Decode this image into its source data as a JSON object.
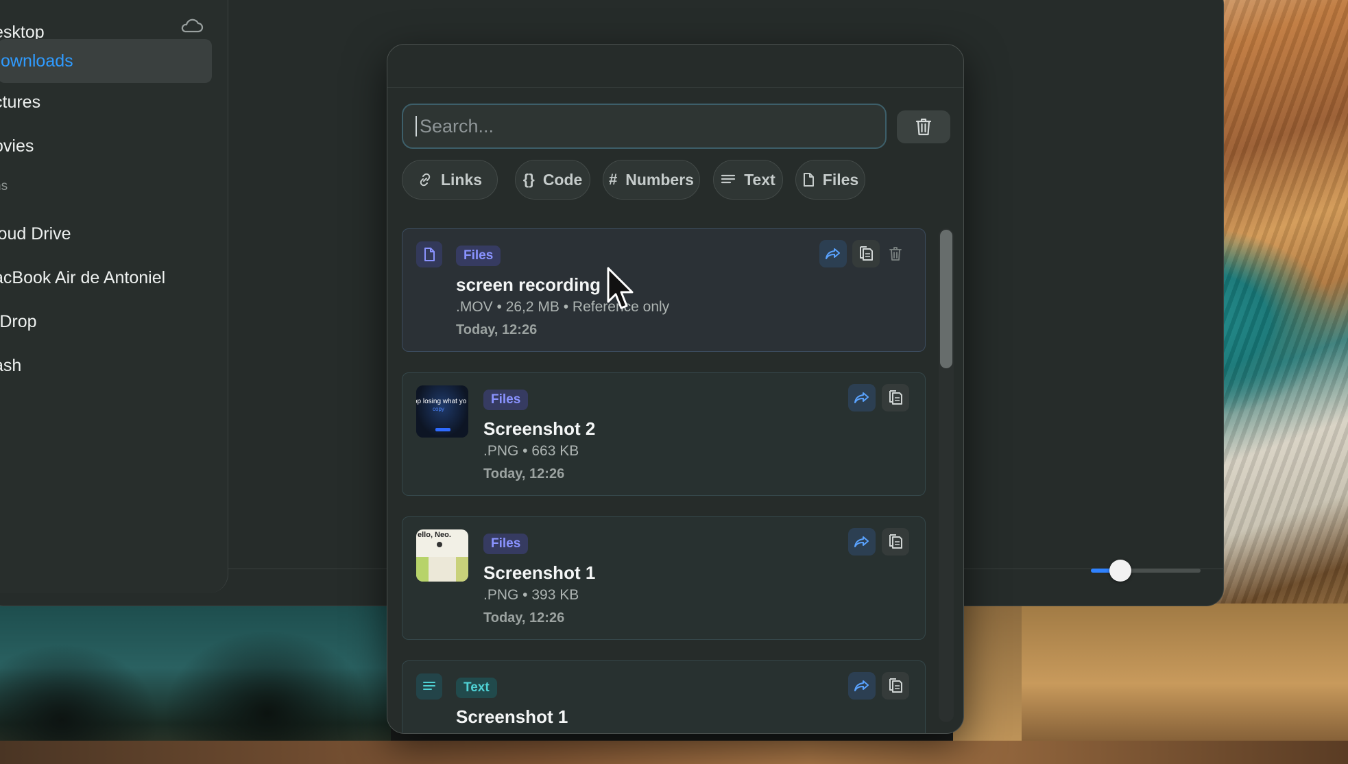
{
  "finder": {
    "sidebar": {
      "items": [
        {
          "label": "esktop",
          "active": false
        },
        {
          "label": "ownloads",
          "active": true
        },
        {
          "label": "ctures",
          "active": false
        },
        {
          "label": "ovies",
          "active": false
        }
      ],
      "section_header": "ns",
      "locations": [
        {
          "label": "loud Drive"
        },
        {
          "label": "acBook Air de Antoniel"
        },
        {
          "label": "rDrop"
        },
        {
          "label": "ash"
        }
      ]
    },
    "zoom_slider": {
      "value_fraction": 0.22
    }
  },
  "panel": {
    "search": {
      "placeholder": "Search...",
      "value": ""
    },
    "filters": [
      {
        "label": "Links",
        "icon": "link-icon"
      },
      {
        "label": "Code",
        "icon": "braces-icon"
      },
      {
        "label": "Numbers",
        "icon": "hash-icon"
      },
      {
        "label": "Text",
        "icon": "lines-icon"
      },
      {
        "label": "Files",
        "icon": "file-icon"
      }
    ],
    "items": [
      {
        "badge": "Files",
        "title": "screen recording",
        "meta": ".MOV • 26,2 MB • Reference only",
        "date": "Today, 12:26"
      },
      {
        "badge": "Files",
        "title": "Screenshot 2",
        "meta": ".PNG • 663 KB",
        "date": "Today, 12:26",
        "thumb_text": "op losing what yo"
      },
      {
        "badge": "Files",
        "title": "Screenshot 1",
        "meta": ".PNG • 393 KB",
        "date": "Today, 12:26",
        "thumb_text": "ello, Neo."
      },
      {
        "badge": "Text",
        "title": "Screenshot 1"
      }
    ]
  },
  "colors": {
    "accent": "#2f9bff",
    "files_badge": "#8a93ff",
    "text_badge": "#4fd1d4"
  }
}
